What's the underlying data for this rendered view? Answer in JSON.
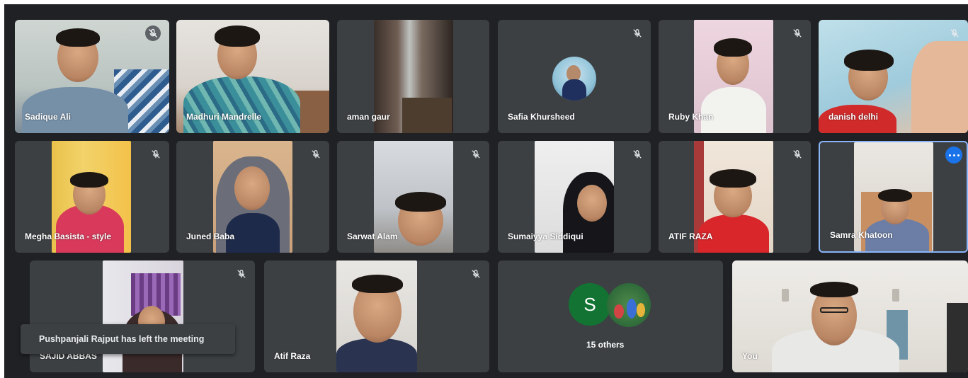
{
  "participants": [
    {
      "name": "Sadique Ali"
    },
    {
      "name": "Madhuri Mandrelle"
    },
    {
      "name": "aman gaur"
    },
    {
      "name": "Safia Khursheed"
    },
    {
      "name": "Ruby Khan"
    },
    {
      "name": "danish delhi"
    },
    {
      "name": "Megha Basista - style"
    },
    {
      "name": "Juned Baba"
    },
    {
      "name": "Sarwat Alam"
    },
    {
      "name": "Sumaiyya Siddiqui"
    },
    {
      "name": "ATIF RAZA"
    },
    {
      "name": "Samra Khatoon"
    },
    {
      "name": "SAJID ABBAS"
    },
    {
      "name": "Atif Raza"
    },
    {
      "name": "You"
    }
  ],
  "others_tile": {
    "avatar_letter": "S",
    "label": "15 others"
  },
  "notification": {
    "text": "Pushpanjali Rajput has left the meeting"
  },
  "icons": {
    "muted": "mic-off-icon",
    "more": "more-options-icon"
  },
  "colors": {
    "background": "#202124",
    "tile": "#3c4043",
    "active_border": "#8ab4f8",
    "more_button": "#1a73e8",
    "avatar_s": "#137333"
  }
}
